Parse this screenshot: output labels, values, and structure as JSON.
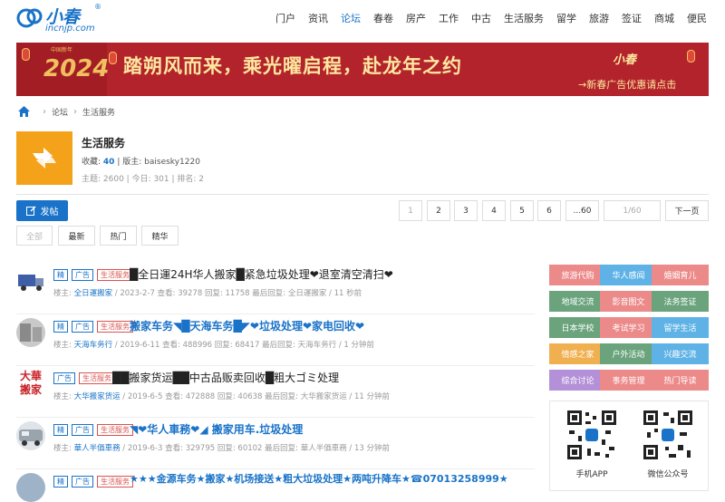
{
  "brand": {
    "name": "小春",
    "domain": "incnjp.com",
    "reg": "®"
  },
  "nav": [
    "门户",
    "资讯",
    "论坛",
    "春卷",
    "房产",
    "工作",
    "中古",
    "生活服务",
    "留学",
    "旅游",
    "签证",
    "商城",
    "便民"
  ],
  "nav_active": "论坛",
  "banner": {
    "year": "2024",
    "cny": "中国新年",
    "slogan": "踏朔风而来，乘光曜启程，赴龙年之约",
    "logo": "小春",
    "promo": "→新春广告优惠请点击"
  },
  "breadcrumb": [
    "论坛",
    "生活服务"
  ],
  "forum": {
    "title": "生活服务",
    "fav_label": "收藏:",
    "fav_count": "40",
    "mod_label": "版主:",
    "moderator": "baisesky1220",
    "stats": "主题: 2600  |  今日: 301  |  排名: 2"
  },
  "post_button": "发帖",
  "pager": {
    "pages": [
      "1",
      "2",
      "3",
      "4",
      "5",
      "6",
      "...60"
    ],
    "jump": "1/60",
    "next": "下一页"
  },
  "filters": [
    "全部",
    "最新",
    "热门",
    "精华"
  ],
  "threads": [
    {
      "tags": [
        "精",
        "广告",
        "生活服务"
      ],
      "title": "█全日運24H华人搬家█紧急垃圾处理❤退室清空清扫❤",
      "title_style": "plain",
      "author_label": "楼主: ",
      "author": "全日運搬家",
      "info": " / 2023-2-7     查看: 39278     回复: 11758     最后回复: 全日運搬家 / 11 秒前"
    },
    {
      "tags": [
        "精",
        "广告",
        "生活服务"
      ],
      "title": "搬家车务◥█天海车务█◤❤垃圾处理❤家电回收❤",
      "title_style": "blue",
      "author_label": "楼主: ",
      "author": "天海车务行",
      "info": " / 2019-6-11     查看: 488996     回复: 68417     最后回复: 天海车务行 / 1 分钟前"
    },
    {
      "tags": [
        "广告",
        "生活服务"
      ],
      "title": "██搬家货运██中古品贩卖回收█粗大ゴミ处理",
      "title_style": "plain",
      "author_label": "楼主: ",
      "author": "大华搬家货运",
      "info": " / 2019-6-5     查看: 472888     回复: 40638     最后回复: 大华搬家货运 / 11 分钟前"
    },
    {
      "tags": [
        "精",
        "广告",
        "生活服务"
      ],
      "title": "◥❤华人車務❤◢ 搬家用车.垃圾处理",
      "title_style": "blue",
      "author_label": "楼主: ",
      "author": "華人半価車務",
      "info": " / 2019-6-3     查看: 329795     回复: 60102     最后回复: 華人半価車務 / 13 分钟前"
    },
    {
      "tags": [
        "精",
        "广告",
        "生活服务"
      ],
      "title": "★★★金源车务★搬家★机场接送★粗大垃圾处理★两吨升降车★☎07013258999★",
      "title_style": "blue",
      "author_label": "",
      "author": "",
      "info": ""
    }
  ],
  "avatar_text": "大華搬家",
  "sidebar": {
    "categories": [
      {
        "label": "旅游代购",
        "color": "#ec8a8a"
      },
      {
        "label": "华人感闻",
        "color": "#5eb2e6"
      },
      {
        "label": "婚姻育儿",
        "color": "#ec8a8a"
      },
      {
        "label": "地域交流",
        "color": "#6aa37c"
      },
      {
        "label": "影音图文",
        "color": "#ec8a8a"
      },
      {
        "label": "法务签证",
        "color": "#6aa37c"
      },
      {
        "label": "日本学校",
        "color": "#6aa37c"
      },
      {
        "label": "考试学习",
        "color": "#ec8a8a"
      },
      {
        "label": "留学生活",
        "color": "#5eb2e6"
      },
      {
        "label": "情感之家",
        "color": "#f0b050"
      },
      {
        "label": "户外活动",
        "color": "#6aa37c"
      },
      {
        "label": "兴趣交流",
        "color": "#5eb2e6"
      },
      {
        "label": "综合讨论",
        "color": "#b490d8"
      },
      {
        "label": "事务管理",
        "color": "#ec8a8a"
      },
      {
        "label": "热门导读",
        "color": "#ec8a8a"
      }
    ],
    "qr_app": "手机APP",
    "qr_wechat": "微信公众号"
  }
}
